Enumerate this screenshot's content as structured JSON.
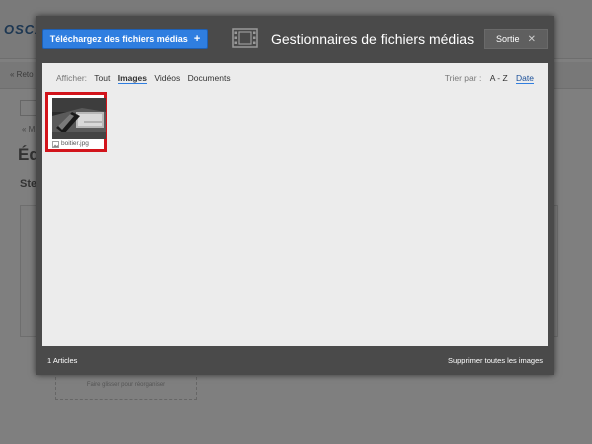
{
  "background": {
    "logo": "OSCA",
    "return_link": "« Reto",
    "breadcrumb": "« M",
    "heading": "Éd",
    "subheading": "Ste",
    "drop_hint": "Faire glisser pour réorganiser"
  },
  "modal": {
    "upload_button": {
      "label": "Téléchargez des fichiers médias",
      "icon": "plus-icon",
      "plus": "+"
    },
    "title_icon": "film-strip-icon",
    "title": "Gestionnaires de fichiers médias",
    "exit_button": {
      "label": "Sortie",
      "close_glyph": "✕"
    },
    "filter": {
      "label": "Afficher:",
      "items": [
        {
          "label": "Tout",
          "active": false
        },
        {
          "label": "Images",
          "active": true
        },
        {
          "label": "Vidéos",
          "active": false
        },
        {
          "label": "Documents",
          "active": false
        }
      ]
    },
    "sort": {
      "label": "Trier par :",
      "items": [
        {
          "label": "A - Z",
          "active": false
        },
        {
          "label": "Date",
          "active": true
        }
      ]
    },
    "files": [
      {
        "name": "boitier.jpg",
        "type_icon": "image-file-icon",
        "selected": true
      }
    ],
    "footer": {
      "count": "1 Articles",
      "delete_all": "Supprimer toutes les images"
    }
  },
  "colors": {
    "accent": "#2f7ee0",
    "selection_border": "#d2141b",
    "modal_bg": "#4a4a4a",
    "content_bg": "#ececec"
  }
}
